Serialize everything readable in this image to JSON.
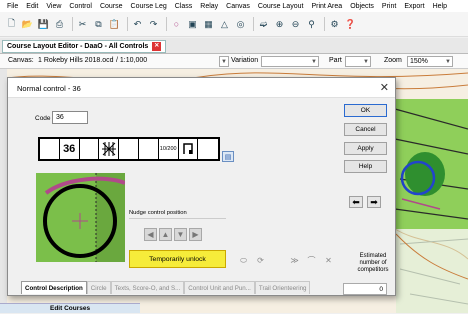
{
  "menu": [
    "File",
    "Edit",
    "View",
    "Control",
    "Course",
    "Course Leg",
    "Class",
    "Relay",
    "Canvas",
    "Course Layout",
    "Print Area",
    "Objects",
    "Print",
    "Export",
    "Help"
  ],
  "toolbar_icons": [
    "new-file-icon",
    "open-folder-icon",
    "save-icon",
    "print-icon",
    "cut-icon",
    "copy-icon",
    "paste-icon",
    "undo-icon",
    "redo-icon",
    "add-control-icon",
    "description-icon",
    "grid-icon",
    "control-icon",
    "finish-icon",
    "start-icon",
    "zoom-in-icon",
    "zoom-out-icon",
    "zoom-all-icon",
    "tools-icon",
    "help-icon"
  ],
  "doc_tab": "Course Layout Editor - DaaO - All Controls",
  "infobar": {
    "canvas_label": "Canvas:",
    "canvas_value": "1 Rokeby Hills 2018.ocd",
    "scale": "/ 1:10,000",
    "variation_label": "Variation",
    "part_label": "Part",
    "zoom_label": "Zoom",
    "zoom_value": "150%"
  },
  "dialog": {
    "title": "Normal control - 36",
    "code_label": "Code",
    "code_value": "36",
    "description_cells": [
      "",
      "36",
      "",
      "▓",
      "",
      "",
      "10/200",
      "□",
      ""
    ],
    "nudge_title": "Nudge control position",
    "unlock_label": "Temporarily unlock",
    "buttons": {
      "ok": "OK",
      "cancel": "Cancel",
      "apply": "Apply",
      "help": "Help"
    },
    "competitors_label": "Estimated number of competitors",
    "competitors_value": "0",
    "tabs": [
      "Control Description",
      "Circle",
      "Texts, Score-O, and S...",
      "Control Unit and Pun...",
      "Trail Orienteering"
    ]
  },
  "bottom_panel_label": "Edit Courses",
  "colors": {
    "highlight": "#f6ec3a",
    "map_green": "#7bbf4a",
    "course_purple": "#b04a8a",
    "blue_circle": "#2244cc"
  }
}
